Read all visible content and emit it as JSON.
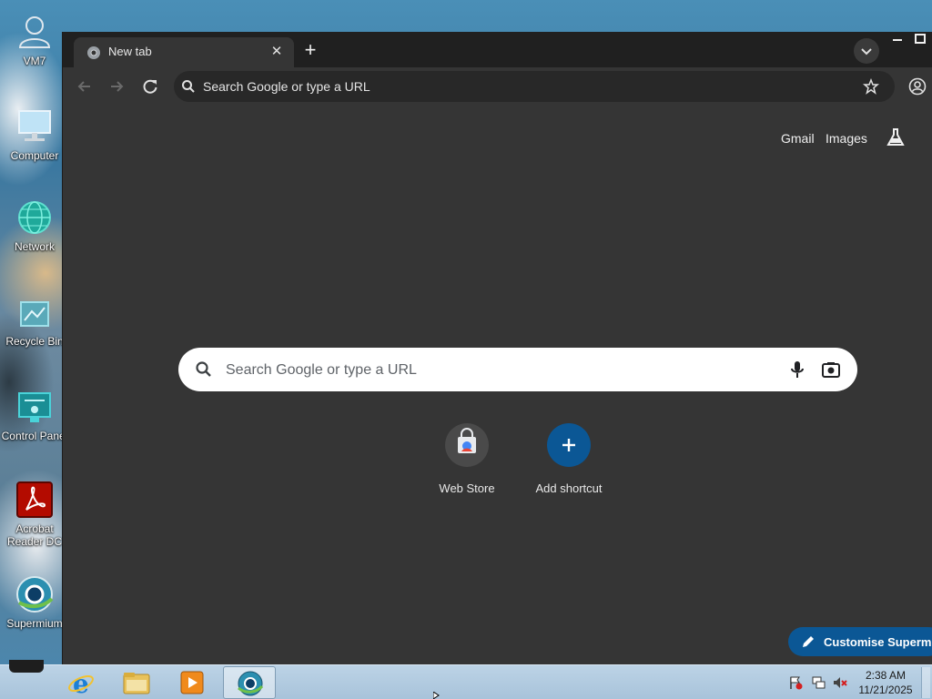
{
  "desktop": {
    "icons": [
      {
        "label": "VM7",
        "icon": "user-icon"
      },
      {
        "label": "Computer",
        "icon": "computer-icon"
      },
      {
        "label": "Network",
        "icon": "network-icon"
      },
      {
        "label": "Recycle Bin",
        "icon": "recycle-bin-icon"
      },
      {
        "label": "Control Panel",
        "icon": "control-panel-icon"
      },
      {
        "label": "Acrobat Reader DC",
        "icon": "acrobat-icon"
      },
      {
        "label": "Supermium",
        "icon": "supermium-icon"
      }
    ]
  },
  "browser": {
    "tab": {
      "title": "New tab",
      "close_label": "✕"
    },
    "new_tab_label": "+",
    "omnibox": {
      "placeholder": "Search Google or type a URL"
    },
    "ntp": {
      "links": {
        "gmail": "Gmail",
        "images": "Images"
      },
      "searchbox": {
        "placeholder": "Search Google or type a URL"
      },
      "shortcuts": [
        {
          "label": "Web Store"
        },
        {
          "label": "Add shortcut"
        }
      ],
      "customise_label": "Customise Supermium"
    }
  },
  "taskbar": {
    "clock": {
      "time": "2:38 AM",
      "date": "11/21/2025"
    }
  },
  "colors": {
    "browser_bg": "#353535",
    "tabstrip_bg": "#202020",
    "omnibox_bg": "#282828",
    "accent_blue": "#0b5795",
    "shortcut_blue": "#0b5795"
  }
}
